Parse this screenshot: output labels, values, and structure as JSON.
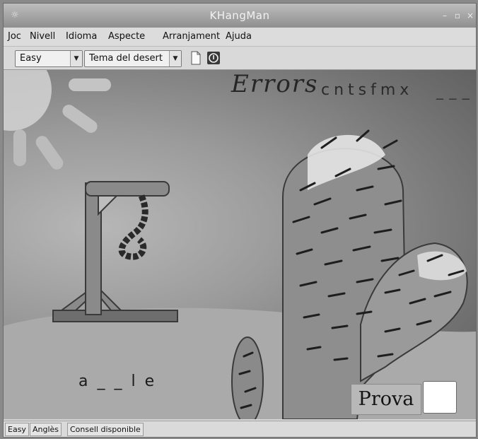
{
  "window": {
    "title": "KHangMan",
    "app_icon": "khangman-icon",
    "controls": [
      "minimize-icon",
      "maximize-icon",
      "close-icon"
    ]
  },
  "menubar": {
    "items": [
      {
        "label": "Joc"
      },
      {
        "label": "Nivell"
      },
      {
        "label": "Idioma"
      },
      {
        "label": "Aspecte"
      },
      {
        "label": "Arranjament"
      },
      {
        "label": "Ajuda"
      }
    ]
  },
  "toolbar": {
    "level_value": "Easy",
    "theme_value": "Tema del desert",
    "icons": [
      "new-document-icon",
      "hint-icon"
    ]
  },
  "game": {
    "errors_label": "Errors",
    "missed_letters": "cntsfmx",
    "remaining_slots": "_ _ _",
    "word": "a _ _ l e",
    "guess_label": "Prova",
    "guess_value": ""
  },
  "statusbar": {
    "level": "Easy",
    "language": "Anglès",
    "hint": "Consell disponible"
  },
  "colors": {
    "sky_light": "#b7b7b7",
    "sky_dark": "#5a5a5a",
    "sand": "#aaaaaa",
    "cactus": "#8c8c8c",
    "gallows": "#777777"
  }
}
